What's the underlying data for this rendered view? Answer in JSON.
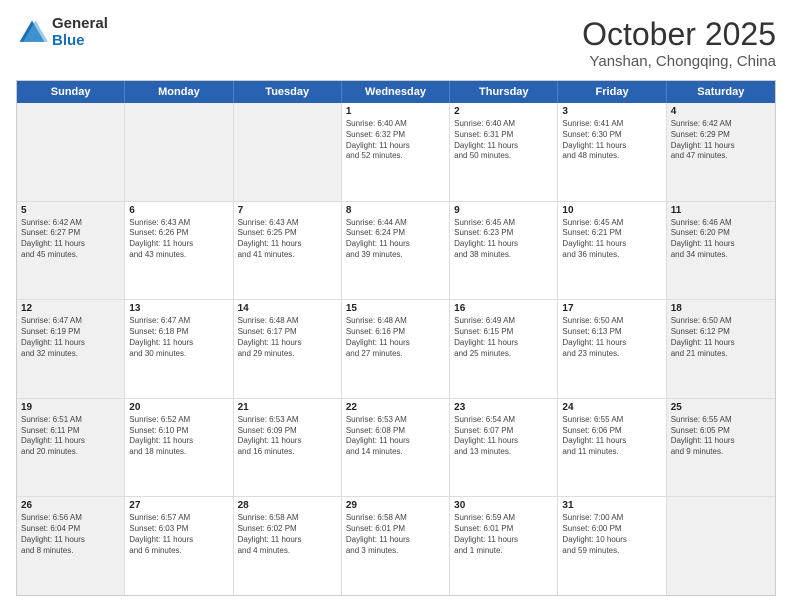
{
  "logo": {
    "general": "General",
    "blue": "Blue"
  },
  "header": {
    "month": "October 2025",
    "location": "Yanshan, Chongqing, China"
  },
  "days": [
    "Sunday",
    "Monday",
    "Tuesday",
    "Wednesday",
    "Thursday",
    "Friday",
    "Saturday"
  ],
  "weeks": [
    [
      {
        "day": "",
        "text": "",
        "shaded": true
      },
      {
        "day": "",
        "text": "",
        "shaded": true
      },
      {
        "day": "",
        "text": "",
        "shaded": true
      },
      {
        "day": "1",
        "text": "Sunrise: 6:40 AM\nSunset: 6:32 PM\nDaylight: 11 hours\nand 52 minutes.",
        "shaded": false
      },
      {
        "day": "2",
        "text": "Sunrise: 6:40 AM\nSunset: 6:31 PM\nDaylight: 11 hours\nand 50 minutes.",
        "shaded": false
      },
      {
        "day": "3",
        "text": "Sunrise: 6:41 AM\nSunset: 6:30 PM\nDaylight: 11 hours\nand 48 minutes.",
        "shaded": false
      },
      {
        "day": "4",
        "text": "Sunrise: 6:42 AM\nSunset: 6:29 PM\nDaylight: 11 hours\nand 47 minutes.",
        "shaded": true
      }
    ],
    [
      {
        "day": "5",
        "text": "Sunrise: 6:42 AM\nSunset: 6:27 PM\nDaylight: 11 hours\nand 45 minutes.",
        "shaded": true
      },
      {
        "day": "6",
        "text": "Sunrise: 6:43 AM\nSunset: 6:26 PM\nDaylight: 11 hours\nand 43 minutes.",
        "shaded": false
      },
      {
        "day": "7",
        "text": "Sunrise: 6:43 AM\nSunset: 6:25 PM\nDaylight: 11 hours\nand 41 minutes.",
        "shaded": false
      },
      {
        "day": "8",
        "text": "Sunrise: 6:44 AM\nSunset: 6:24 PM\nDaylight: 11 hours\nand 39 minutes.",
        "shaded": false
      },
      {
        "day": "9",
        "text": "Sunrise: 6:45 AM\nSunset: 6:23 PM\nDaylight: 11 hours\nand 38 minutes.",
        "shaded": false
      },
      {
        "day": "10",
        "text": "Sunrise: 6:45 AM\nSunset: 6:21 PM\nDaylight: 11 hours\nand 36 minutes.",
        "shaded": false
      },
      {
        "day": "11",
        "text": "Sunrise: 6:46 AM\nSunset: 6:20 PM\nDaylight: 11 hours\nand 34 minutes.",
        "shaded": true
      }
    ],
    [
      {
        "day": "12",
        "text": "Sunrise: 6:47 AM\nSunset: 6:19 PM\nDaylight: 11 hours\nand 32 minutes.",
        "shaded": true
      },
      {
        "day": "13",
        "text": "Sunrise: 6:47 AM\nSunset: 6:18 PM\nDaylight: 11 hours\nand 30 minutes.",
        "shaded": false
      },
      {
        "day": "14",
        "text": "Sunrise: 6:48 AM\nSunset: 6:17 PM\nDaylight: 11 hours\nand 29 minutes.",
        "shaded": false
      },
      {
        "day": "15",
        "text": "Sunrise: 6:48 AM\nSunset: 6:16 PM\nDaylight: 11 hours\nand 27 minutes.",
        "shaded": false
      },
      {
        "day": "16",
        "text": "Sunrise: 6:49 AM\nSunset: 6:15 PM\nDaylight: 11 hours\nand 25 minutes.",
        "shaded": false
      },
      {
        "day": "17",
        "text": "Sunrise: 6:50 AM\nSunset: 6:13 PM\nDaylight: 11 hours\nand 23 minutes.",
        "shaded": false
      },
      {
        "day": "18",
        "text": "Sunrise: 6:50 AM\nSunset: 6:12 PM\nDaylight: 11 hours\nand 21 minutes.",
        "shaded": true
      }
    ],
    [
      {
        "day": "19",
        "text": "Sunrise: 6:51 AM\nSunset: 6:11 PM\nDaylight: 11 hours\nand 20 minutes.",
        "shaded": true
      },
      {
        "day": "20",
        "text": "Sunrise: 6:52 AM\nSunset: 6:10 PM\nDaylight: 11 hours\nand 18 minutes.",
        "shaded": false
      },
      {
        "day": "21",
        "text": "Sunrise: 6:53 AM\nSunset: 6:09 PM\nDaylight: 11 hours\nand 16 minutes.",
        "shaded": false
      },
      {
        "day": "22",
        "text": "Sunrise: 6:53 AM\nSunset: 6:08 PM\nDaylight: 11 hours\nand 14 minutes.",
        "shaded": false
      },
      {
        "day": "23",
        "text": "Sunrise: 6:54 AM\nSunset: 6:07 PM\nDaylight: 11 hours\nand 13 minutes.",
        "shaded": false
      },
      {
        "day": "24",
        "text": "Sunrise: 6:55 AM\nSunset: 6:06 PM\nDaylight: 11 hours\nand 11 minutes.",
        "shaded": false
      },
      {
        "day": "25",
        "text": "Sunrise: 6:55 AM\nSunset: 6:05 PM\nDaylight: 11 hours\nand 9 minutes.",
        "shaded": true
      }
    ],
    [
      {
        "day": "26",
        "text": "Sunrise: 6:56 AM\nSunset: 6:04 PM\nDaylight: 11 hours\nand 8 minutes.",
        "shaded": true
      },
      {
        "day": "27",
        "text": "Sunrise: 6:57 AM\nSunset: 6:03 PM\nDaylight: 11 hours\nand 6 minutes.",
        "shaded": false
      },
      {
        "day": "28",
        "text": "Sunrise: 6:58 AM\nSunset: 6:02 PM\nDaylight: 11 hours\nand 4 minutes.",
        "shaded": false
      },
      {
        "day": "29",
        "text": "Sunrise: 6:58 AM\nSunset: 6:01 PM\nDaylight: 11 hours\nand 3 minutes.",
        "shaded": false
      },
      {
        "day": "30",
        "text": "Sunrise: 6:59 AM\nSunset: 6:01 PM\nDaylight: 11 hours\nand 1 minute.",
        "shaded": false
      },
      {
        "day": "31",
        "text": "Sunrise: 7:00 AM\nSunset: 6:00 PM\nDaylight: 10 hours\nand 59 minutes.",
        "shaded": false
      },
      {
        "day": "",
        "text": "",
        "shaded": true
      }
    ]
  ]
}
